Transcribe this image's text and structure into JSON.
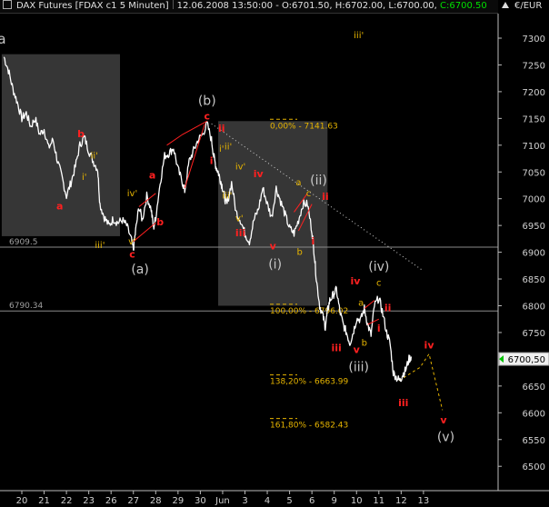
{
  "header": {
    "symbol": "DAX Futures [FDAX c1 5 Minuten]",
    "date": "12.06.2008 13:50:00",
    "open": "O:6701.50",
    "high": "H:6702.00",
    "low": "L:6700.00",
    "close": "C:6700.50",
    "currency": "€/EUR",
    "close_color": "#00e000"
  },
  "chart_data": {
    "type": "line",
    "title": "",
    "xlabel": "",
    "ylabel": "",
    "ylim": [
      6450,
      7350
    ],
    "y_ticks": [
      6500,
      6550,
      6600,
      6650,
      6700,
      6750,
      6800,
      6850,
      6900,
      6950,
      7000,
      7050,
      7100,
      7150,
      7200,
      7250,
      7300
    ],
    "x_ticks": [
      {
        "i": 0,
        "label": "20"
      },
      {
        "i": 1,
        "label": "21"
      },
      {
        "i": 2,
        "label": "22"
      },
      {
        "i": 3,
        "label": "23"
      },
      {
        "i": 4,
        "label": "26"
      },
      {
        "i": 5,
        "label": "27"
      },
      {
        "i": 6,
        "label": "28"
      },
      {
        "i": 7,
        "label": "29"
      },
      {
        "i": 8,
        "label": "30"
      },
      {
        "i": 9,
        "label": "Jun"
      },
      {
        "i": 10,
        "label": "3"
      },
      {
        "i": 11,
        "label": "4"
      },
      {
        "i": 12,
        "label": "5"
      },
      {
        "i": 13,
        "label": "6"
      },
      {
        "i": 14,
        "label": "9"
      },
      {
        "i": 15,
        "label": "10"
      },
      {
        "i": 16,
        "label": "11"
      },
      {
        "i": 17,
        "label": "12"
      },
      {
        "i": 18,
        "label": "13"
      }
    ],
    "price_series": [
      [
        -0.8,
        7265
      ],
      [
        -0.6,
        7240
      ],
      [
        -0.4,
        7205
      ],
      [
        -0.2,
        7180
      ],
      [
        0.0,
        7150
      ],
      [
        0.2,
        7160
      ],
      [
        0.4,
        7135
      ],
      [
        0.6,
        7150
      ],
      [
        0.8,
        7120
      ],
      [
        1.0,
        7130
      ],
      [
        1.2,
        7095
      ],
      [
        1.4,
        7110
      ],
      [
        1.6,
        7070
      ],
      [
        1.8,
        7040
      ],
      [
        2.0,
        7005
      ],
      [
        2.2,
        7030
      ],
      [
        2.4,
        7060
      ],
      [
        2.6,
        7100
      ],
      [
        2.8,
        7115
      ],
      [
        3.0,
        7090
      ],
      [
        3.2,
        7070
      ],
      [
        3.4,
        7055
      ],
      [
        3.5,
        6990
      ],
      [
        3.7,
        6965
      ],
      [
        3.9,
        6950
      ],
      [
        4.1,
        6962
      ],
      [
        4.3,
        6955
      ],
      [
        4.5,
        6960
      ],
      [
        4.7,
        6950
      ],
      [
        4.9,
        6925
      ],
      [
        5.0,
        6905
      ],
      [
        5.1,
        6940
      ],
      [
        5.25,
        6985
      ],
      [
        5.4,
        6960
      ],
      [
        5.6,
        7005
      ],
      [
        5.8,
        6980
      ],
      [
        5.9,
        6945
      ],
      [
        6.0,
        6965
      ],
      [
        6.2,
        7030
      ],
      [
        6.4,
        7080
      ],
      [
        6.6,
        7085
      ],
      [
        6.8,
        7095
      ],
      [
        7.0,
        7055
      ],
      [
        7.2,
        7030
      ],
      [
        7.3,
        7015
      ],
      [
        7.5,
        7070
      ],
      [
        7.7,
        7090
      ],
      [
        7.9,
        7110
      ],
      [
        8.1,
        7120
      ],
      [
        8.3,
        7140
      ],
      [
        8.5,
        7110
      ],
      [
        8.6,
        7080
      ],
      [
        8.7,
        7060
      ],
      [
        8.8,
        7050
      ],
      [
        8.9,
        7035
      ],
      [
        9.0,
        7020
      ],
      [
        9.1,
        7000
      ],
      [
        9.2,
        6990
      ],
      [
        9.4,
        7030
      ],
      [
        9.6,
        6975
      ],
      [
        9.8,
        6960
      ],
      [
        10.0,
        6935
      ],
      [
        10.2,
        6920
      ],
      [
        10.4,
        6960
      ],
      [
        10.6,
        6980
      ],
      [
        10.8,
        7020
      ],
      [
        11.0,
        6990
      ],
      [
        11.2,
        6965
      ],
      [
        11.4,
        7020
      ],
      [
        11.6,
        6995
      ],
      [
        11.8,
        6970
      ],
      [
        12.0,
        6945
      ],
      [
        12.2,
        6935
      ],
      [
        12.4,
        6960
      ],
      [
        12.6,
        6990
      ],
      [
        12.8,
        6990
      ],
      [
        13.0,
        6940
      ],
      [
        13.1,
        6900
      ],
      [
        13.2,
        6850
      ],
      [
        13.35,
        6800
      ],
      [
        13.5,
        6780
      ],
      [
        13.6,
        6760
      ],
      [
        13.7,
        6790
      ],
      [
        13.8,
        6810
      ],
      [
        13.95,
        6820
      ],
      [
        14.1,
        6830
      ],
      [
        14.25,
        6790
      ],
      [
        14.4,
        6765
      ],
      [
        14.55,
        6750
      ],
      [
        14.7,
        6730
      ],
      [
        14.85,
        6750
      ],
      [
        15.0,
        6775
      ],
      [
        15.2,
        6775
      ],
      [
        15.35,
        6795
      ],
      [
        15.5,
        6765
      ],
      [
        15.65,
        6745
      ],
      [
        15.8,
        6800
      ],
      [
        16.0,
        6815
      ],
      [
        16.15,
        6790
      ],
      [
        16.35,
        6750
      ],
      [
        16.5,
        6730
      ],
      [
        16.65,
        6675
      ],
      [
        16.8,
        6665
      ],
      [
        16.95,
        6660
      ],
      [
        17.05,
        6670
      ],
      [
        17.2,
        6680
      ],
      [
        17.35,
        6700
      ],
      [
        17.45,
        6705
      ]
    ],
    "fib_levels": [
      {
        "label": "0,00% - 7141.63",
        "value": 7141.63
      },
      {
        "label": "100,00% - 6796.02",
        "value": 6796.02
      },
      {
        "label": "138,20% - 6663.99",
        "value": 6663.99
      },
      {
        "label": "161,80% - 6582.43",
        "value": 6582.43
      }
    ],
    "hlines": [
      {
        "label": "6909.5",
        "value": 6909.5
      },
      {
        "label": "6790.34",
        "value": 6790.34
      }
    ],
    "last_price": {
      "label": "6700,50",
      "value": 6700.5
    },
    "boxes": [
      {
        "i0": -0.9,
        "i1": 4.4,
        "y0": 6930,
        "y1": 7270
      },
      {
        "i0": 8.8,
        "i1": 13.7,
        "y0": 6800,
        "y1": 7145
      }
    ],
    "trendline": [
      [
        8.5,
        7140
      ],
      [
        18.0,
        6865
      ]
    ],
    "projection": [
      [
        16.9,
        6660
      ],
      [
        17.85,
        6685
      ],
      [
        18.25,
        6710
      ],
      [
        18.85,
        6605
      ]
    ],
    "red_lines": [
      [
        [
          6.5,
          7100
        ],
        [
          7.2,
          7120
        ],
        [
          8.3,
          7145
        ]
      ],
      [
        [
          7.3,
          7020
        ],
        [
          8.2,
          7140
        ]
      ],
      [
        [
          5.0,
          6920
        ],
        [
          6.0,
          6955
        ]
      ],
      [
        [
          5.25,
          6985
        ],
        [
          6.0,
          7010
        ]
      ],
      [
        [
          12.2,
          6975
        ],
        [
          12.8,
          7010
        ]
      ],
      [
        [
          12.4,
          6940
        ],
        [
          13.0,
          6990
        ]
      ],
      [
        [
          15.35,
          6795
        ],
        [
          15.8,
          6810
        ]
      ],
      [
        [
          15.5,
          6765
        ],
        [
          16.0,
          6775
        ]
      ]
    ],
    "wave_labels": [
      {
        "text": "a",
        "i": -0.9,
        "y": 7290,
        "color": "#c8c8c8",
        "size": 15,
        "bold": false
      },
      {
        "text": "iii'",
        "i": 15.1,
        "y": 7300,
        "color": "#e6b400",
        "size": 10,
        "bold": false
      },
      {
        "text": "a",
        "i": 1.7,
        "y": 6980,
        "color": "#ff2020",
        "size": 11,
        "bold": true
      },
      {
        "text": "b",
        "i": 2.65,
        "y": 7115,
        "color": "#ff2020",
        "size": 11,
        "bold": true
      },
      {
        "text": "ii'",
        "i": 3.25,
        "y": 7075,
        "color": "#e6b400",
        "size": 10,
        "bold": false
      },
      {
        "text": "i'",
        "i": 2.8,
        "y": 7035,
        "color": "#e6b400",
        "size": 10,
        "bold": false
      },
      {
        "text": "iii'",
        "i": 3.5,
        "y": 6908,
        "color": "#e6b400",
        "size": 10,
        "bold": false
      },
      {
        "text": "iv'",
        "i": 4.95,
        "y": 7005,
        "color": "#e6b400",
        "size": 10,
        "bold": false
      },
      {
        "text": "v'",
        "i": 4.95,
        "y": 6915,
        "color": "#e6b400",
        "size": 10,
        "bold": false
      },
      {
        "text": "c",
        "i": 4.95,
        "y": 6890,
        "color": "#ff2020",
        "size": 11,
        "bold": true
      },
      {
        "text": "a",
        "i": 5.85,
        "y": 7038,
        "color": "#ff2020",
        "size": 11,
        "bold": true
      },
      {
        "text": "b",
        "i": 6.2,
        "y": 6950,
        "color": "#ff2020",
        "size": 11,
        "bold": true
      },
      {
        "text": "(a)",
        "i": 5.3,
        "y": 6860,
        "color": "#c8c8c8",
        "size": 14,
        "bold": false
      },
      {
        "text": "(b)",
        "i": 8.3,
        "y": 7175,
        "color": "#c8c8c8",
        "size": 14,
        "bold": false
      },
      {
        "text": "c",
        "i": 8.3,
        "y": 7148,
        "color": "#ff2020",
        "size": 11,
        "bold": true
      },
      {
        "text": "ii",
        "i": 8.95,
        "y": 7125,
        "color": "#ff2020",
        "size": 11,
        "bold": true
      },
      {
        "text": "ii'",
        "i": 9.25,
        "y": 7092,
        "color": "#e6b400",
        "size": 10,
        "bold": false
      },
      {
        "text": "i'",
        "i": 8.95,
        "y": 7088,
        "color": "#e6b400",
        "size": 10,
        "bold": false
      },
      {
        "text": "i",
        "i": 8.5,
        "y": 7065,
        "color": "#ff2020",
        "size": 11,
        "bold": true
      },
      {
        "text": "iv'",
        "i": 9.8,
        "y": 7055,
        "color": "#e6b400",
        "size": 10,
        "bold": false
      },
      {
        "text": "iv",
        "i": 10.6,
        "y": 7040,
        "color": "#ff2020",
        "size": 11,
        "bold": true
      },
      {
        "text": "iii'",
        "i": 9.2,
        "y": 7000,
        "color": "#e6b400",
        "size": 10,
        "bold": false
      },
      {
        "text": "v'",
        "i": 9.75,
        "y": 6958,
        "color": "#e6b400",
        "size": 10,
        "bold": false
      },
      {
        "text": "iii",
        "i": 9.8,
        "y": 6930,
        "color": "#ff2020",
        "size": 11,
        "bold": true
      },
      {
        "text": "v",
        "i": 11.25,
        "y": 6905,
        "color": "#ff2020",
        "size": 11,
        "bold": true
      },
      {
        "text": "(i)",
        "i": 11.35,
        "y": 6870,
        "color": "#c8c8c8",
        "size": 14,
        "bold": false
      },
      {
        "text": "a",
        "i": 12.4,
        "y": 7025,
        "color": "#e6b400",
        "size": 10,
        "bold": false
      },
      {
        "text": "c",
        "i": 12.85,
        "y": 7005,
        "color": "#e6b400",
        "size": 10,
        "bold": false
      },
      {
        "text": "(ii)",
        "i": 13.3,
        "y": 7027,
        "color": "#c8c8c8",
        "size": 14,
        "bold": false
      },
      {
        "text": "b",
        "i": 12.45,
        "y": 6895,
        "color": "#e6b400",
        "size": 10,
        "bold": false
      },
      {
        "text": "ii",
        "i": 13.6,
        "y": 6998,
        "color": "#ff2020",
        "size": 11,
        "bold": true
      },
      {
        "text": "i",
        "i": 13.05,
        "y": 6915,
        "color": "#ff2020",
        "size": 11,
        "bold": true
      },
      {
        "text": "iv",
        "i": 14.95,
        "y": 6840,
        "color": "#ff2020",
        "size": 11,
        "bold": true
      },
      {
        "text": "(iv)",
        "i": 16.0,
        "y": 6865,
        "color": "#c8c8c8",
        "size": 14,
        "bold": false
      },
      {
        "text": "c",
        "i": 16.0,
        "y": 6837,
        "color": "#e6b400",
        "size": 10,
        "bold": false
      },
      {
        "text": "a",
        "i": 15.2,
        "y": 6800,
        "color": "#e6b400",
        "size": 10,
        "bold": false
      },
      {
        "text": "ii",
        "i": 16.4,
        "y": 6790,
        "color": "#ff2020",
        "size": 11,
        "bold": true
      },
      {
        "text": "i",
        "i": 16.0,
        "y": 6752,
        "color": "#ff2020",
        "size": 11,
        "bold": true
      },
      {
        "text": "iii",
        "i": 14.1,
        "y": 6715,
        "color": "#ff2020",
        "size": 11,
        "bold": true
      },
      {
        "text": "b",
        "i": 15.35,
        "y": 6725,
        "color": "#e6b400",
        "size": 10,
        "bold": false
      },
      {
        "text": "v",
        "i": 15.0,
        "y": 6712,
        "color": "#ff2020",
        "size": 11,
        "bold": true
      },
      {
        "text": "(iii)",
        "i": 15.1,
        "y": 6678,
        "color": "#c8c8c8",
        "size": 14,
        "bold": false
      },
      {
        "text": "iii",
        "i": 17.1,
        "y": 6612,
        "color": "#ff2020",
        "size": 11,
        "bold": true
      },
      {
        "text": "iv",
        "i": 18.25,
        "y": 6720,
        "color": "#ff2020",
        "size": 11,
        "bold": true
      },
      {
        "text": "v",
        "i": 18.9,
        "y": 6580,
        "color": "#ff2020",
        "size": 11,
        "bold": true
      },
      {
        "text": "(v)",
        "i": 19.0,
        "y": 6547,
        "color": "#c8c8c8",
        "size": 14,
        "bold": false
      }
    ]
  }
}
